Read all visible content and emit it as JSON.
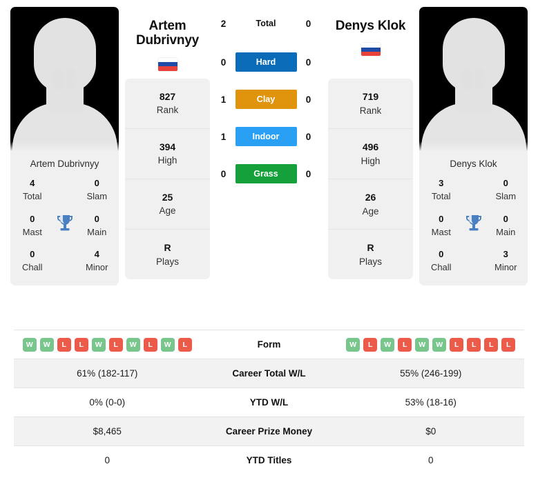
{
  "players": {
    "left": {
      "name_full": "Artem Dubrivnyy",
      "name_display_line1": "Artem",
      "name_display_line2": "Dubrivnyy",
      "country_flag": "russia-flag",
      "flag_colors": [
        "#ffffff",
        "#1e4ba8",
        "#e8413a"
      ],
      "rank_stats": [
        {
          "value": "827",
          "label": "Rank"
        },
        {
          "value": "394",
          "label": "High"
        },
        {
          "value": "25",
          "label": "Age"
        },
        {
          "value": "R",
          "label": "Plays"
        }
      ],
      "titles": {
        "total": "4",
        "slam": "0",
        "mast": "0",
        "main": "0",
        "chall": "0",
        "minor": "4"
      },
      "form": [
        "W",
        "W",
        "L",
        "L",
        "W",
        "L",
        "W",
        "L",
        "W",
        "L"
      ],
      "career_total_wl": "61% (182-117)",
      "ytd_wl": "0% (0-0)",
      "career_prize_money": "$8,465",
      "ytd_titles": "0"
    },
    "right": {
      "name_full": "Denys Klok",
      "name_display_line1": "Denys Klok",
      "name_display_line2": "",
      "country_flag": "russia-flag",
      "flag_colors": [
        "#ffffff",
        "#1e4ba8",
        "#e8413a"
      ],
      "rank_stats": [
        {
          "value": "719",
          "label": "Rank"
        },
        {
          "value": "496",
          "label": "High"
        },
        {
          "value": "26",
          "label": "Age"
        },
        {
          "value": "R",
          "label": "Plays"
        }
      ],
      "titles": {
        "total": "3",
        "slam": "0",
        "mast": "0",
        "main": "0",
        "chall": "0",
        "minor": "3"
      },
      "form": [
        "W",
        "L",
        "W",
        "L",
        "W",
        "W",
        "L",
        "L",
        "L",
        "L"
      ],
      "career_total_wl": "55% (246-199)",
      "ytd_wl": "53% (18-16)",
      "career_prize_money": "$0",
      "ytd_titles": "0"
    }
  },
  "titles_labels": {
    "total": "Total",
    "slam": "Slam",
    "mast": "Mast",
    "main": "Main",
    "chall": "Chall",
    "minor": "Minor",
    "trophy_icon": "trophy-icon"
  },
  "head_to_head": [
    {
      "label": "Total",
      "left": "2",
      "right": "0",
      "color": "",
      "text_color": "#111111"
    },
    {
      "label": "Hard",
      "left": "0",
      "right": "0",
      "color": "#0a6cb8",
      "text_color": "#ffffff"
    },
    {
      "label": "Clay",
      "left": "1",
      "right": "0",
      "color": "#e0930c",
      "text_color": "#ffffff"
    },
    {
      "label": "Indoor",
      "left": "1",
      "right": "0",
      "color": "#2aa0f5",
      "text_color": "#ffffff"
    },
    {
      "label": "Grass",
      "left": "0",
      "right": "0",
      "color": "#15a03b",
      "text_color": "#ffffff"
    }
  ],
  "comparison_rows": [
    {
      "label": "Form",
      "type": "form",
      "left": "",
      "right": ""
    },
    {
      "label": "Career Total W/L",
      "type": "text",
      "left": "61% (182-117)",
      "right": "55% (246-199)"
    },
    {
      "label": "YTD W/L",
      "type": "text",
      "left": "0% (0-0)",
      "right": "53% (18-16)"
    },
    {
      "label": "Career Prize Money",
      "type": "text",
      "left": "$8,465",
      "right": "$0"
    },
    {
      "label": "YTD Titles",
      "type": "text",
      "left": "0",
      "right": "0"
    }
  ],
  "colors": {
    "form_win": "#79c68d",
    "form_loss": "#ec5b4a",
    "card_bg": "#f0f0f0",
    "row_shade": "#f2f2f2"
  }
}
